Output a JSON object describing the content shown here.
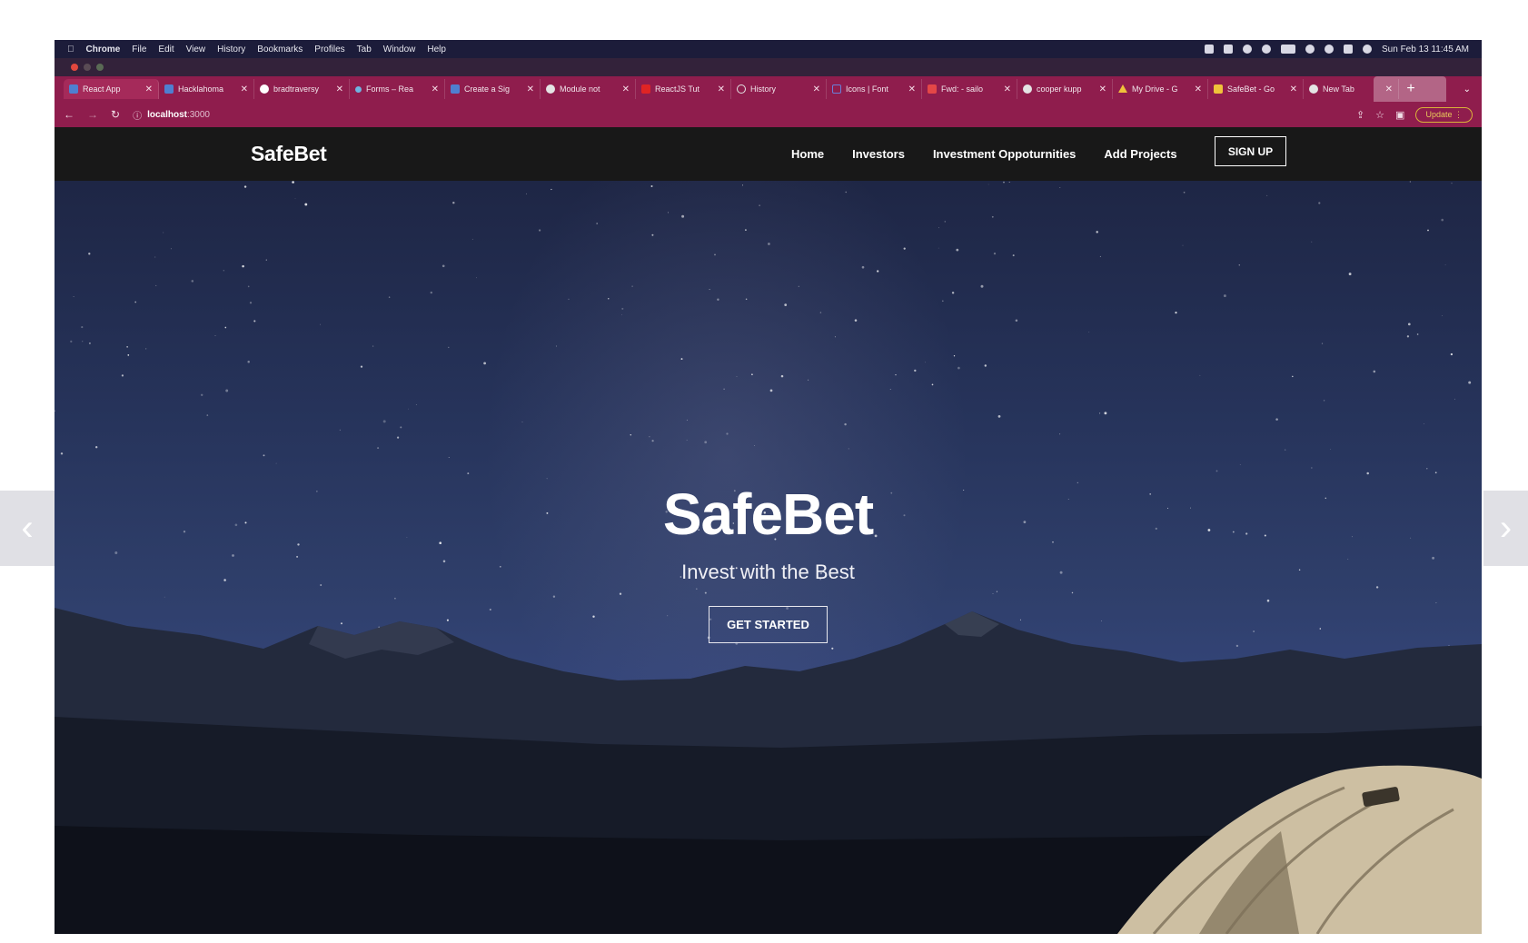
{
  "menubar": {
    "apple": "",
    "items": [
      "Chrome",
      "File",
      "Edit",
      "View",
      "History",
      "Bookmarks",
      "Profiles",
      "Tab",
      "Window",
      "Help"
    ],
    "datetime": "Sun Feb 13  11:45 AM"
  },
  "tabs": [
    {
      "label": "React App",
      "active": true,
      "favicon_color": "#4f7fd0"
    },
    {
      "label": "Hacklahoma",
      "favicon_color": "#4f7fd0"
    },
    {
      "label": "bradtraversy",
      "favicon_color": "#ffffff"
    },
    {
      "label": "Forms – Rea",
      "favicon_color": "#6fb4e0"
    },
    {
      "label": "Create a Sig",
      "favicon_color": "#4f7fd0"
    },
    {
      "label": "Module not",
      "favicon_color": "#e4e4e4"
    },
    {
      "label": "ReactJS Tut",
      "favicon_color": "#e02424"
    },
    {
      "label": "History",
      "favicon_color": "#e4e4e4"
    },
    {
      "label": "Icons | Font",
      "favicon_color": "#6a7fd8"
    },
    {
      "label": "Fwd: - sailo",
      "favicon_color": "#e44747"
    },
    {
      "label": "cooper kupp",
      "favicon_color": "#e4e4e4"
    },
    {
      "label": "My Drive - G",
      "favicon_color": "#f0c23a"
    },
    {
      "label": "SafeBet - Go",
      "favicon_color": "#f0c23a"
    },
    {
      "label": "New Tab",
      "favicon_color": "#e4e4e4"
    }
  ],
  "address": {
    "host": "localhost",
    "port": ":3000",
    "update_label": "Update"
  },
  "site": {
    "logo": "SafeBet",
    "nav": [
      "Home",
      "Investors",
      "Investment Oppoturnities",
      "Add Projects"
    ],
    "signup": "SIGN UP"
  },
  "hero": {
    "title": "SafeBet",
    "subtitle": "Invest with the Best",
    "cta": "GET STARTED"
  },
  "icons": {
    "back": "arrow-left-icon",
    "forward": "arrow-right-icon",
    "reload": "reload-icon",
    "info": "info-icon",
    "share": "share-icon",
    "star": "bookmark-star-icon",
    "new_tab": "plus-icon",
    "carousel_prev": "chevron-left-icon",
    "carousel_next": "chevron-right-icon"
  },
  "colors": {
    "tab_bar": "#8f1d4d",
    "site_nav": "#181818",
    "hero_sky": "#2f3f6b"
  }
}
